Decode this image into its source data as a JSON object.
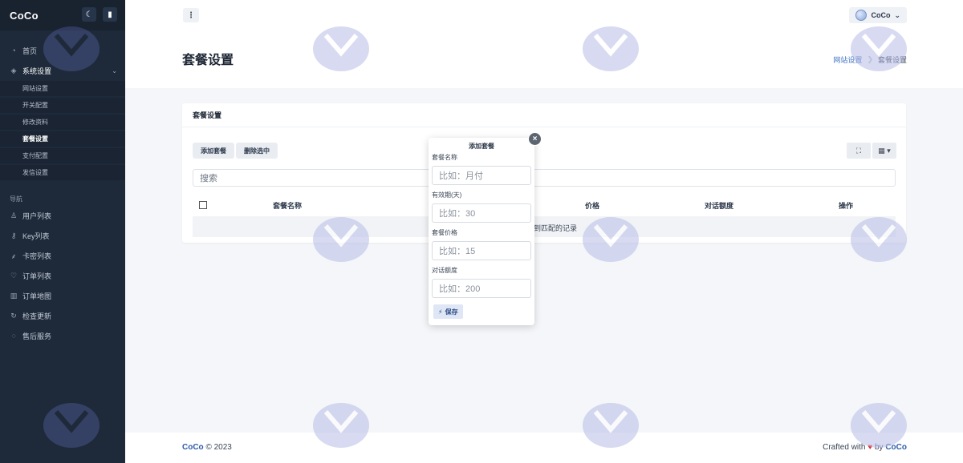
{
  "app": {
    "brand": "CoCo"
  },
  "sidebar": {
    "top_icons": [
      "moon-icon",
      "pin-icon"
    ],
    "items": [
      {
        "label": "首页",
        "icon": "dashboard-icon"
      },
      {
        "label": "系统设置",
        "icon": "layers-icon"
      },
      {
        "label": "用户列表",
        "icon": "users-icon"
      },
      {
        "label": "Key列表",
        "icon": "key-icon"
      },
      {
        "label": "卡密列表",
        "icon": "feather-icon"
      },
      {
        "label": "订单列表",
        "icon": "heart-icon"
      },
      {
        "label": "订单地图",
        "icon": "map-icon"
      },
      {
        "label": "检查更新",
        "icon": "refresh-icon"
      },
      {
        "label": "售后服务",
        "icon": "chat-icon"
      }
    ],
    "sub_items": [
      "网站设置",
      "开关配置",
      "修改资料",
      "套餐设置",
      "支付配置",
      "发信设置"
    ],
    "nav_section_label": "导航"
  },
  "topbar": {
    "user_name": "CoCo"
  },
  "page": {
    "title": "套餐设置",
    "breadcrumb": [
      "网站设置",
      "套餐设置"
    ]
  },
  "card": {
    "title": "套餐设置",
    "add_button": "添加套餐",
    "delete_button": "删除选中",
    "search_placeholder": "搜索",
    "columns": [
      "套餐名称",
      "价格",
      "对话额度",
      "操作"
    ],
    "empty_text": "到匹配的记录"
  },
  "modal": {
    "title": "添加套餐",
    "fields": [
      {
        "label": "套餐名称",
        "placeholder": "比如：月付"
      },
      {
        "label": "有效期(天)",
        "placeholder": "比如：30"
      },
      {
        "label": "套餐价格",
        "placeholder": "比如：15"
      },
      {
        "label": "对话额度",
        "placeholder": "比如：200"
      }
    ],
    "save_label": "保存"
  },
  "footer": {
    "left_brand": "CoCo",
    "left_text": "© 2023",
    "right_text": "Crafted with",
    "right_by": "by",
    "right_brand": "CoCo"
  }
}
